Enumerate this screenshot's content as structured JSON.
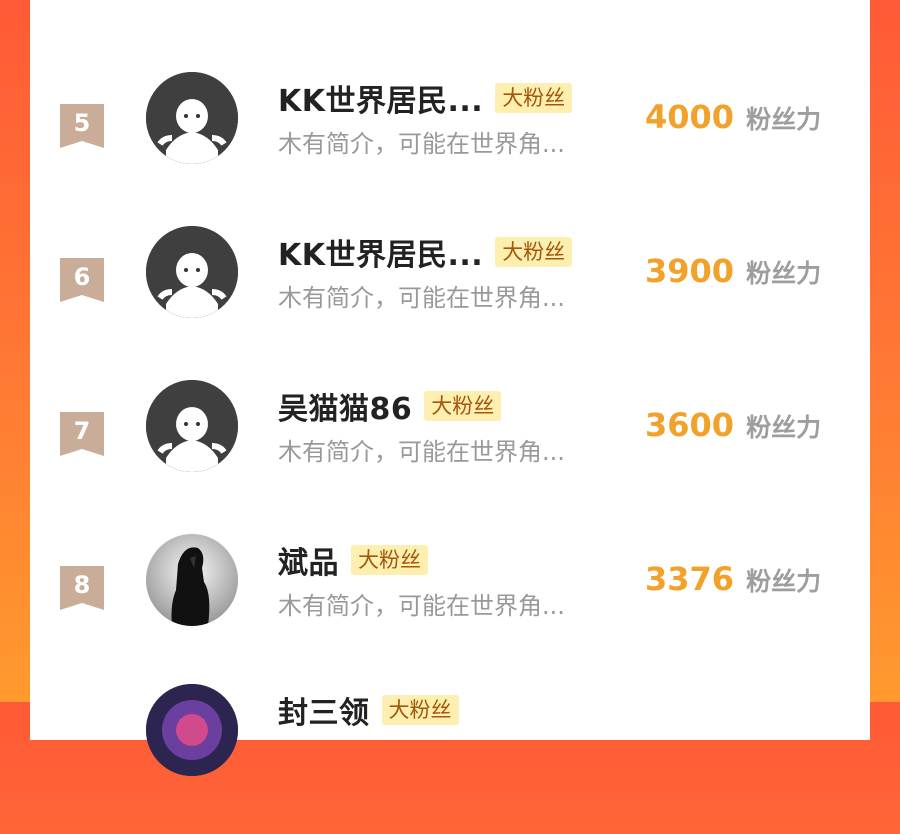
{
  "suffix": "粉丝力",
  "rows": [
    {
      "rank": "5",
      "name": "KK世界居民...",
      "badge": "大粉丝",
      "bio": "木有简介，可能在世界角...",
      "score": "4000",
      "avatar": "default-avatar-icon"
    },
    {
      "rank": "6",
      "name": "KK世界居民...",
      "badge": "大粉丝",
      "bio": "木有简介，可能在世界角...",
      "score": "3900",
      "avatar": "default-avatar-icon"
    },
    {
      "rank": "7",
      "name": "吴猫猫86",
      "badge": "大粉丝",
      "bio": "木有简介，可能在世界角...",
      "score": "3600",
      "avatar": "default-avatar-icon"
    },
    {
      "rank": "8",
      "name": "斌品",
      "badge": "大粉丝",
      "bio": "木有简介，可能在世界角...",
      "score": "3376",
      "avatar": "anime-avatar"
    }
  ],
  "partial_bottom": {
    "name": "封三领",
    "badge": "大粉丝"
  }
}
